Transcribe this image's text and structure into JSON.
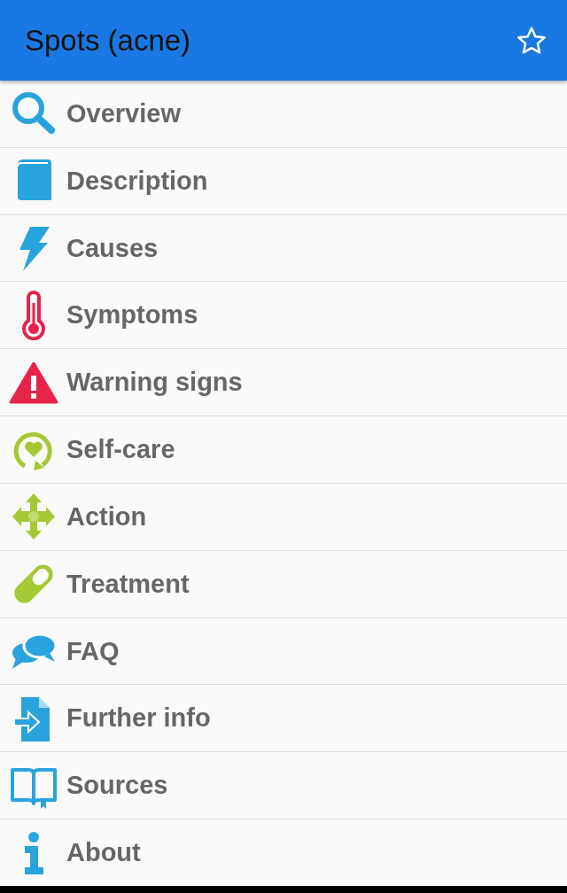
{
  "app_bar": {
    "title": "Spots (acne)",
    "favorite": false
  },
  "menu": [
    {
      "label": "Overview",
      "kind": "search"
    },
    {
      "label": "Description",
      "kind": "book"
    },
    {
      "label": "Causes",
      "kind": "bolt"
    },
    {
      "label": "Symptoms",
      "kind": "thermometer"
    },
    {
      "label": "Warning signs",
      "kind": "warning"
    },
    {
      "label": "Self-care",
      "kind": "heart"
    },
    {
      "label": "Action",
      "kind": "arrows"
    },
    {
      "label": "Treatment",
      "kind": "pill"
    },
    {
      "label": "FAQ",
      "kind": "chat"
    },
    {
      "label": "Further info",
      "kind": "document"
    },
    {
      "label": "Sources",
      "kind": "openbook"
    },
    {
      "label": "About",
      "kind": "info"
    }
  ]
}
